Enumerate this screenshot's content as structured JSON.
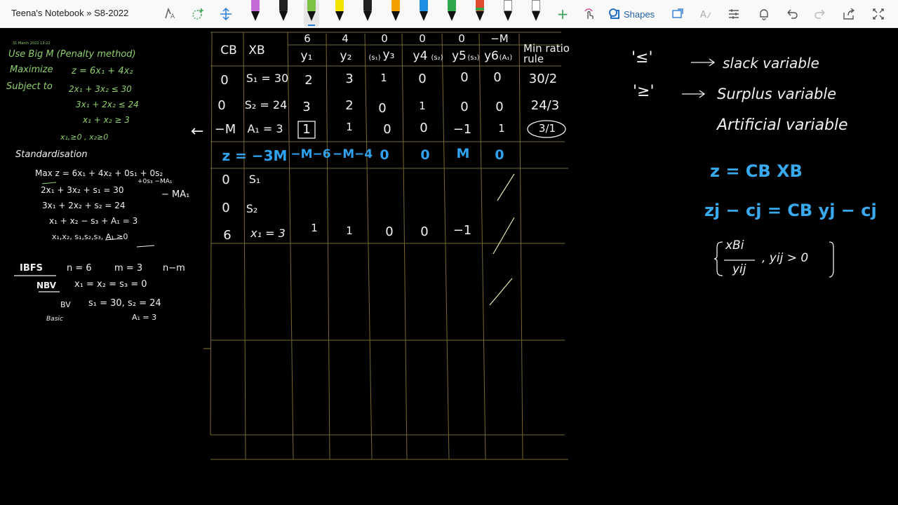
{
  "toolbar": {
    "breadcrumb": "Teena's Notebook » S8-2022",
    "shapes_label": "Shapes",
    "pens": [
      {
        "color": "#c46bd8",
        "name": "pen-purple"
      },
      {
        "color": "#222222",
        "name": "pen-black"
      },
      {
        "color": "#7dc242",
        "name": "pen-green"
      },
      {
        "color": "#f2e600",
        "name": "pen-yellow"
      },
      {
        "color": "#222222",
        "name": "pen-black-2"
      },
      {
        "color": "#f4a100",
        "name": "pen-orange"
      },
      {
        "color": "#1c8fe3",
        "name": "pen-blue"
      },
      {
        "color": "#2ea84a",
        "name": "pen-dark-green"
      },
      {
        "color": "#e04a2f",
        "name": "pen-red"
      },
      {
        "color": "#ffffff",
        "name": "pen-white"
      },
      {
        "color": "#ffffff",
        "name": "pen-white-2"
      }
    ],
    "icons": [
      "lasso-select-icon",
      "add-space-icon",
      "insert-space-icon",
      "add-pen-icon",
      "touch-draw-icon",
      "ink-to-shape-icon",
      "ink-to-text-icon",
      "ink-replay-icon",
      "ruler-icon",
      "bell-icon",
      "undo-icon",
      "redo-icon",
      "share-icon",
      "full-screen-icon"
    ]
  },
  "left_notes": {
    "date": "31 March 2022  13:22",
    "line1": "Use Big M (Penalty method)",
    "maximize_label": "Maximize",
    "objective": "z = 6x₁ + 4x₂",
    "subject_to": "Subject to",
    "c1": "2x₁ + 3x₂ ≤ 30",
    "c2": "3x₁ + 2x₂ ≤ 24",
    "c3": "x₁ + x₂ ≥ 3",
    "nonneg": "x₁,≥0 , x₂≥0",
    "standardisation": "Standardisation",
    "max_std": "Max z = 6x₁ + 4x₂ + 0s₁ + 0s₂",
    "max_std2": "+0s₃ −MA₁",
    "std1": "2x₁ + 3x₂ + s₁ = 30",
    "std2": "3x₁ + 2x₂ + s₂ = 24",
    "std3": "x₁ + x₂ − s₃ + A₁ = 3",
    "std4": "x₁,x₂, s₁,s₂,s₃, A₁ ≥0",
    "minus_ma": "− MA₁",
    "ibfs": "IBFS",
    "n_eq": "n = 6",
    "m_eq": "m = 3",
    "n_minus_m": "n−m",
    "nbv": "NBV",
    "nbv_vals": "x₁ = x₂ = s₃ = 0",
    "bv": "BV",
    "bv_vals": "s₁ = 30, s₂ = 24",
    "basic": "Basic",
    "a1_val": "A₁ = 3"
  },
  "table": {
    "cj_row": [
      "6",
      "4",
      "0",
      "0",
      "0",
      "−M"
    ],
    "header": [
      "CB",
      "XB",
      "y₁",
      "y₂",
      "y₃",
      "y4",
      "y5",
      "y6",
      "Min ratio rule"
    ],
    "header_tags": [
      "(s₁)",
      "(s₂)",
      "(s₃)",
      "(A₁)"
    ],
    "rows": [
      [
        "0",
        "S₁ = 30",
        "2",
        "3",
        "1",
        "0",
        "0",
        "0",
        "30/2"
      ],
      [
        "0",
        "S₂ = 24",
        "3",
        "2",
        "0",
        "1",
        "0",
        "0",
        "24/3"
      ],
      [
        "−M",
        "A₁ = 3",
        "1",
        "1",
        "0",
        "0",
        "−1",
        "1",
        "3/1"
      ]
    ],
    "z_row": [
      "z = −3M",
      "−M−6",
      "−M−4",
      "0",
      "0",
      "M",
      "0"
    ],
    "row2": [
      [
        "0",
        "S₁"
      ],
      [
        "0",
        "S₂"
      ],
      [
        "6",
        "x₁ = 3",
        "1",
        "1",
        "0",
        "0",
        "−1"
      ]
    ],
    "arrow": "←"
  },
  "right_notes": {
    "le": "'≤'",
    "slack": "slack variable",
    "ge": "'≥'",
    "surplus": "Surplus variable",
    "artificial": "Artificial variable",
    "z_formula": "z = CB XB",
    "zj_formula": "zj − cj = CB yj − cj",
    "ratio_num": "xBi",
    "ratio_den": "yij",
    "ratio_cond": ", yij > 0"
  }
}
